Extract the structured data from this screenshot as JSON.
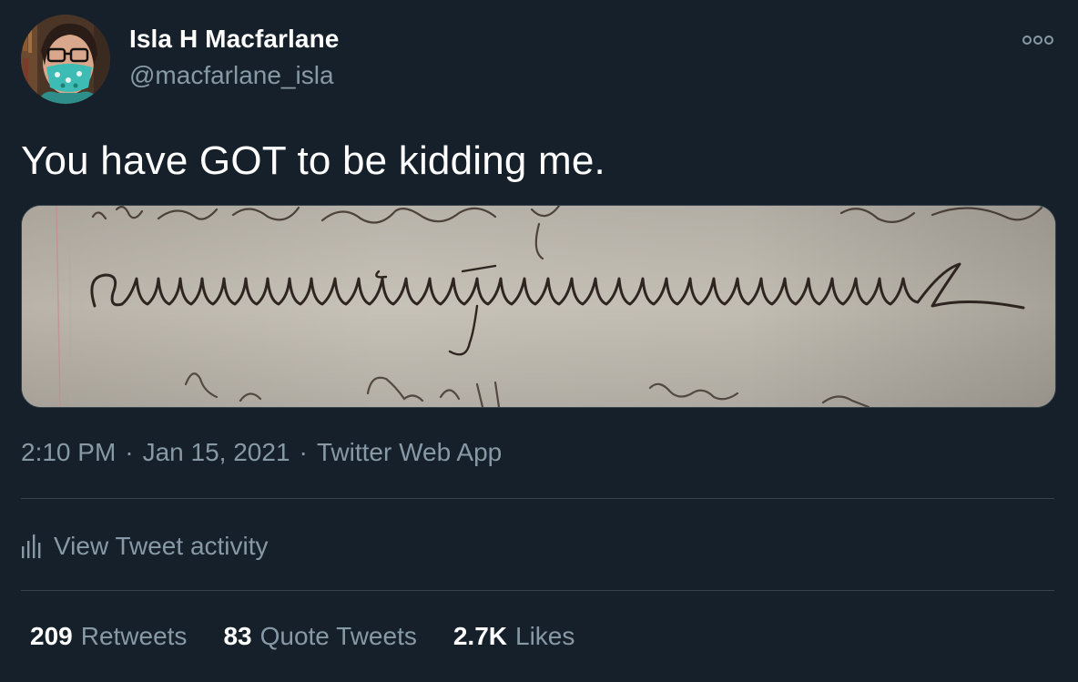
{
  "author": {
    "name": "Isla H Macfarlane",
    "handle": "@macfarlane_isla"
  },
  "tweet": {
    "text": "You have GOT to be kidding me."
  },
  "meta": {
    "time": "2:10 PM",
    "separator": "·",
    "date": "Jan 15, 2021",
    "app": "Twitter Web App"
  },
  "activity": {
    "label": "View Tweet activity"
  },
  "stats": [
    {
      "count": "209",
      "label": "Retweets"
    },
    {
      "count": "83",
      "label": "Quote Tweets"
    },
    {
      "count": "2.7K",
      "label": "Likes"
    }
  ],
  "icons": {
    "more": "more-horizontal-icon",
    "activity": "bar-chart-icon"
  },
  "colors": {
    "background": "#15202b",
    "text_primary": "#ffffff",
    "text_secondary": "#8899a6",
    "divider": "#38444d"
  }
}
